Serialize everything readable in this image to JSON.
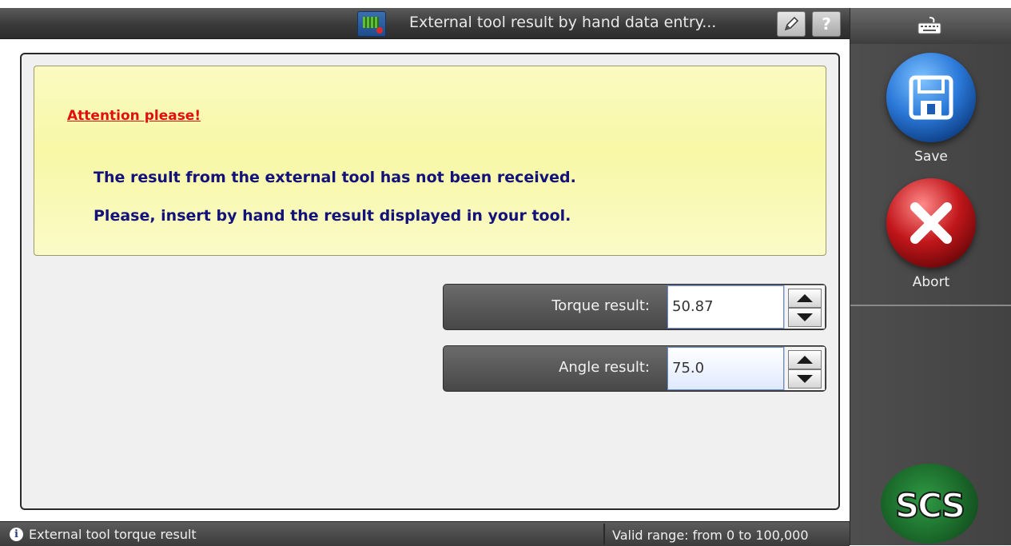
{
  "window": {
    "title": "External tool result by hand data entry..."
  },
  "notice": {
    "heading": "Attention please!",
    "message_line_1": "The result from the external tool has not been received.",
    "message_line_2": "Please, insert by hand the result displayed in your tool."
  },
  "fields": {
    "torque": {
      "label": "Torque result:",
      "value": "50.87"
    },
    "angle": {
      "label": "Angle result:",
      "value": "75.0"
    }
  },
  "sidebar": {
    "save_label": "Save",
    "abort_label": "Abort",
    "logo_text": "SCS"
  },
  "statusbar": {
    "hint": "External tool torque result",
    "range": "Valid range: from 0 to 100,000"
  },
  "icons": {
    "app": "tool-monitor-icon",
    "edit": "pencil-icon",
    "help": "help-icon",
    "keyboard": "keyboard-icon",
    "save": "floppy-disk-icon",
    "abort": "close-x-icon",
    "info": "info-icon"
  },
  "colors": {
    "notice_background": "#f8f8a6",
    "heading_red": "#e01010",
    "message_navy": "#12127a",
    "save_blue": "#2b79d9",
    "abort_red": "#c2171b"
  }
}
